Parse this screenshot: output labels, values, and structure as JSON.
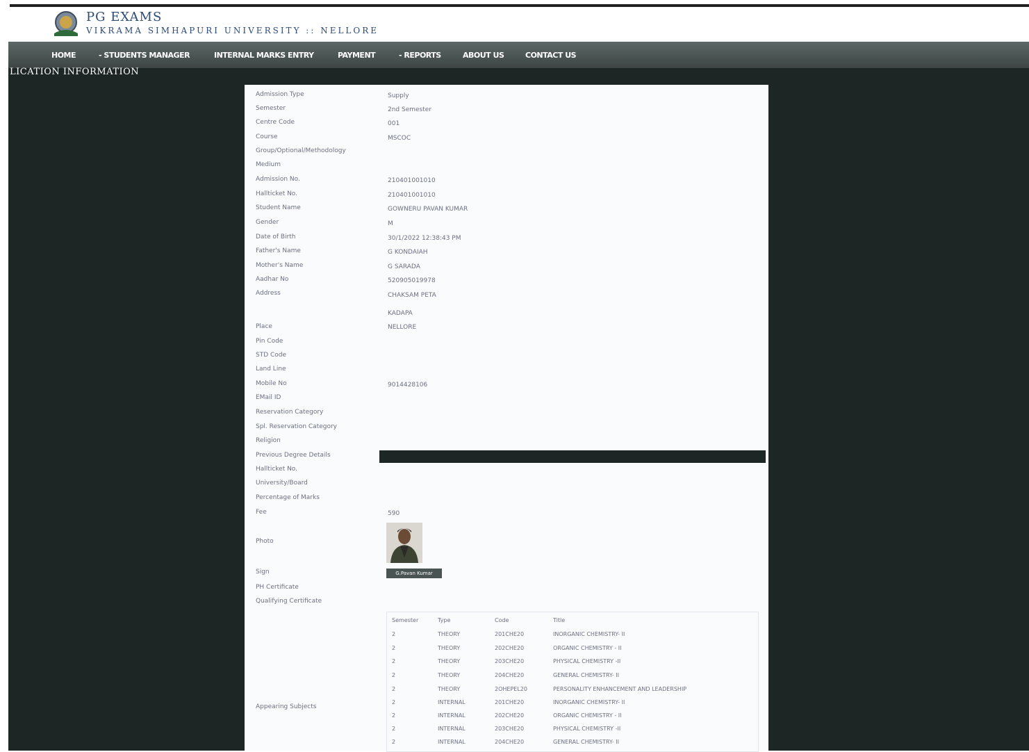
{
  "header": {
    "title": "PG EXAMS",
    "subtitle": "VIKRAMA SIMHAPURI UNIVERSITY :: NELLORE"
  },
  "nav": {
    "items": [
      "HOME",
      "- STUDENTS MANAGER",
      "INTERNAL MARKS ENTRY",
      "PAYMENT",
      "- REPORTS",
      "ABOUT US",
      "CONTACT US"
    ]
  },
  "page": {
    "section_title": "LICATION INFORMATION"
  },
  "fields": [
    {
      "label": "Admission Type",
      "value": "Supply"
    },
    {
      "label": "Semester",
      "value": "2nd Semester"
    },
    {
      "label": "Centre Code",
      "value": "001"
    },
    {
      "label": "Course",
      "value": "MSCOC"
    },
    {
      "label": "Group/Optional/Methodology",
      "value": ""
    },
    {
      "label": "Medium",
      "value": ""
    },
    {
      "label": "Admission No.",
      "value": "210401001010"
    },
    {
      "label": "Hallticket No.",
      "value": "210401001010"
    },
    {
      "label": "Student Name",
      "value": "GOWNERU PAVAN KUMAR"
    },
    {
      "label": "Gender",
      "value": "M"
    },
    {
      "label": "Date of Birth",
      "value": "30/1/2022 12:38:43 PM"
    },
    {
      "label": "Father's Name",
      "value": "G KONDAIAH"
    },
    {
      "label": "Mother's Name",
      "value": "G SARADA"
    },
    {
      "label": "Aadhar No",
      "value": "520905019978"
    },
    {
      "label": "Address",
      "value": "CHAKSAM PETA"
    },
    {
      "label": "",
      "value": "KADAPA"
    },
    {
      "label": "Place",
      "value": "NELLORE"
    },
    {
      "label": "Pin Code",
      "value": ""
    },
    {
      "label": "STD Code",
      "value": ""
    },
    {
      "label": "Land Line",
      "value": ""
    },
    {
      "label": "Mobile No",
      "value": "9014428106"
    },
    {
      "label": "EMail ID",
      "value": ""
    },
    {
      "label": "Reservation Category",
      "value": ""
    },
    {
      "label": "Spl. Reservation Category",
      "value": ""
    },
    {
      "label": "Religion",
      "value": ""
    },
    {
      "label": "Previous Degree Details",
      "value": ""
    },
    {
      "label": "Hallticket No.",
      "value": ""
    },
    {
      "label": "University/Board",
      "value": ""
    },
    {
      "label": "Percentage of Marks",
      "value": ""
    },
    {
      "label": "Fee",
      "value": "590"
    }
  ],
  "media": {
    "photo_label": "Photo",
    "sign_label": "Sign",
    "sign_text": "G.Pavan Kumar",
    "ph_certificate_label": "PH Certificate",
    "qualifying_certificate_label": "Qualifying Certificate"
  },
  "subjects": {
    "label": "Appearing Subjects",
    "headers": [
      "Semester",
      "Type",
      "Code",
      "Title"
    ],
    "rows": [
      [
        "2",
        "THEORY",
        "201CHE20",
        "INORGANIC CHEMISTRY- II"
      ],
      [
        "2",
        "THEORY",
        "202CHE20",
        "ORGANIC CHEMISTRY - II"
      ],
      [
        "2",
        "THEORY",
        "203CHE20",
        "PHYSICAL CHEMISTRY -II"
      ],
      [
        "2",
        "THEORY",
        "204CHE20",
        "GENERAL CHEMISTRY- II"
      ],
      [
        "2",
        "THEORY",
        "2OHEPEL20",
        "PERSONALITY ENHANCEMENT AND LEADERSHIP"
      ],
      [
        "2",
        "INTERNAL",
        "201CHE20",
        "INORGANIC CHEMISTRY- II"
      ],
      [
        "2",
        "INTERNAL",
        "202CHE20",
        "ORGANIC CHEMISTRY - II"
      ],
      [
        "2",
        "INTERNAL",
        "203CHE20",
        "PHYSICAL CHEMISTRY -II"
      ],
      [
        "2",
        "INTERNAL",
        "204CHE20",
        "GENERAL CHEMISTRY- II"
      ]
    ]
  }
}
